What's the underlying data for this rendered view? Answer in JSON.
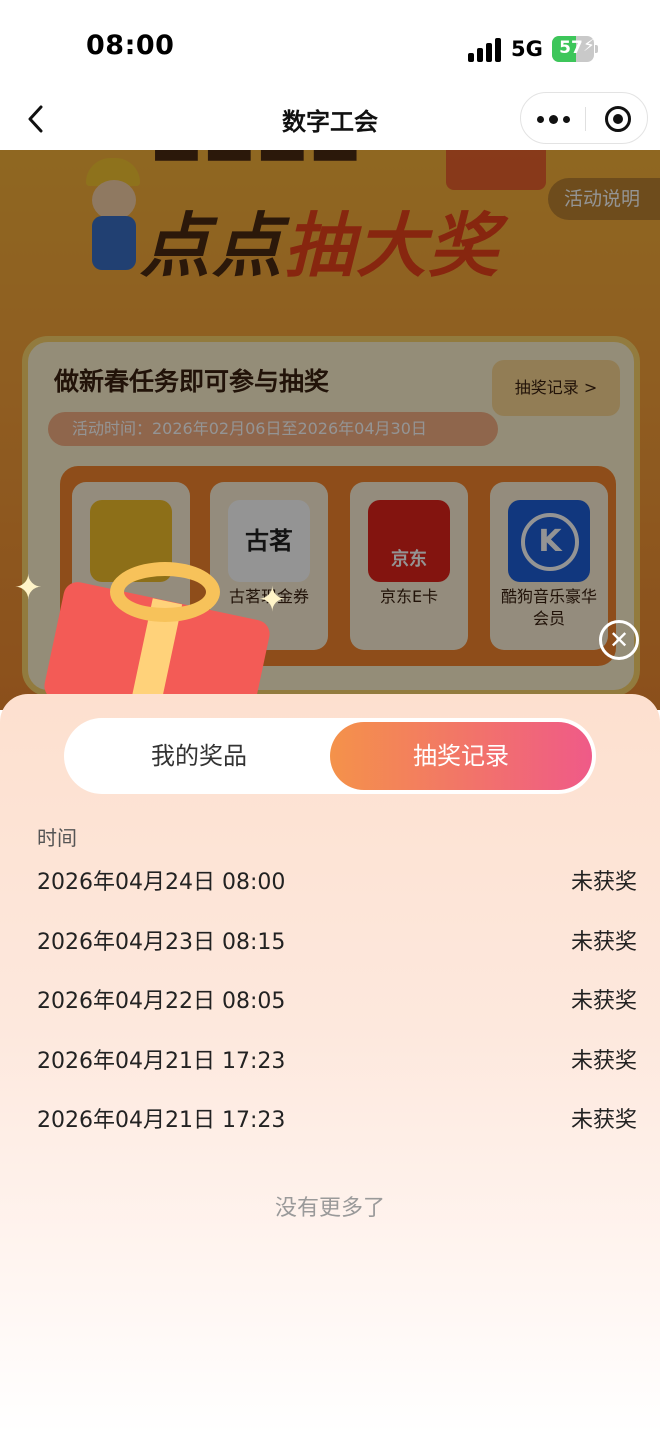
{
  "status_bar": {
    "time": "08:00",
    "network": "5G",
    "battery_level": 57,
    "battery_text": "57"
  },
  "nav": {
    "title": "数字工会",
    "back_icon": "chevron-left-icon",
    "more_icon": "more-dots-icon",
    "close_icon": "target-circle-icon"
  },
  "background_page": {
    "banner_title_plain": "点点",
    "banner_title_highlight": "抽大奖",
    "activity_explain": "活动说明",
    "task_title": "做新春任务即可参与抽奖",
    "activity_time": "活动时间：2026年02月06日至2026年04月30日",
    "draw_record_link": "抽奖记录 >",
    "prizes": [
      {
        "name": "",
        "logo": "tent-icon"
      },
      {
        "name": "古茗现金券",
        "logo": "guming-logo",
        "logo_text": "古茗"
      },
      {
        "name": "京东E卡",
        "logo": "jd-logo",
        "logo_text": "京东"
      },
      {
        "name": "酷狗音乐豪华会员",
        "logo": "kugou-logo"
      }
    ]
  },
  "sheet": {
    "tabs": [
      {
        "label": "我的奖品",
        "active": false
      },
      {
        "label": "抽奖记录",
        "active": true
      }
    ],
    "list_header": "时间",
    "records": [
      {
        "time": "2026年04月24日 08:00",
        "result": "未获奖"
      },
      {
        "time": "2026年04月23日 08:15",
        "result": "未获奖"
      },
      {
        "time": "2026年04月22日 08:05",
        "result": "未获奖"
      },
      {
        "time": "2026年04月21日 17:23",
        "result": "未获奖"
      },
      {
        "time": "2026年04月21日 17:23",
        "result": "未获奖"
      }
    ],
    "footer": "没有更多了"
  },
  "colors": {
    "accent_gradient_start": "#f4924a",
    "accent_gradient_end": "#ef5a88",
    "battery_green": "#3dc65a"
  }
}
